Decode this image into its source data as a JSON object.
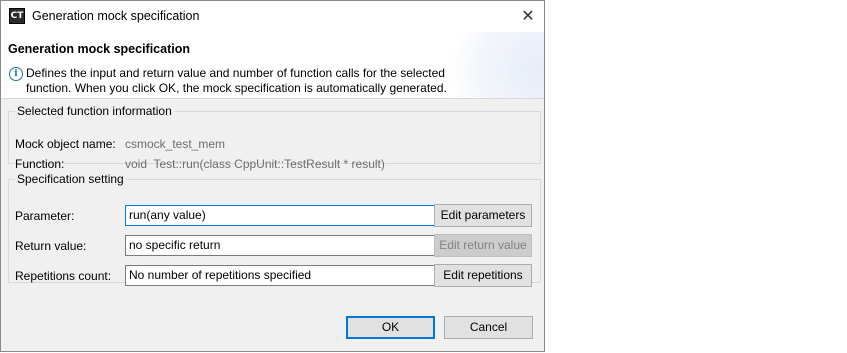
{
  "window": {
    "title": "Generation mock specification",
    "app_icon_text": "CT",
    "close_glyph": "✕"
  },
  "banner": {
    "title": "Generation mock specification",
    "info_icon": "info-icon",
    "description": "Defines the input and return value and number of function calls for the selected function. When you click OK, the mock specification is automatically generated."
  },
  "selected_function": {
    "legend": "Selected function information",
    "mock_object_label": "Mock object name:",
    "mock_object_value": "csmock_test_mem",
    "function_label": "Function:",
    "function_value": "void  Test::run(class CppUnit::TestResult * result)"
  },
  "specification": {
    "legend": "Specification setting",
    "parameter_label": "Parameter:",
    "parameter_value": "run(any value)",
    "edit_parameters_label": "Edit parameters",
    "return_label": "Return value:",
    "return_value": "no specific return",
    "edit_return_label": "Edit return value",
    "repetitions_label": "Repetitions count:",
    "repetitions_value": "No number of repetitions specified",
    "edit_repetitions_label": "Edit repetitions"
  },
  "footer": {
    "ok_label": "OK",
    "cancel_label": "Cancel"
  },
  "colors": {
    "accent": "#0078d7",
    "dialog_bg": "#f0f0f0",
    "info": "#1c6bb3"
  }
}
